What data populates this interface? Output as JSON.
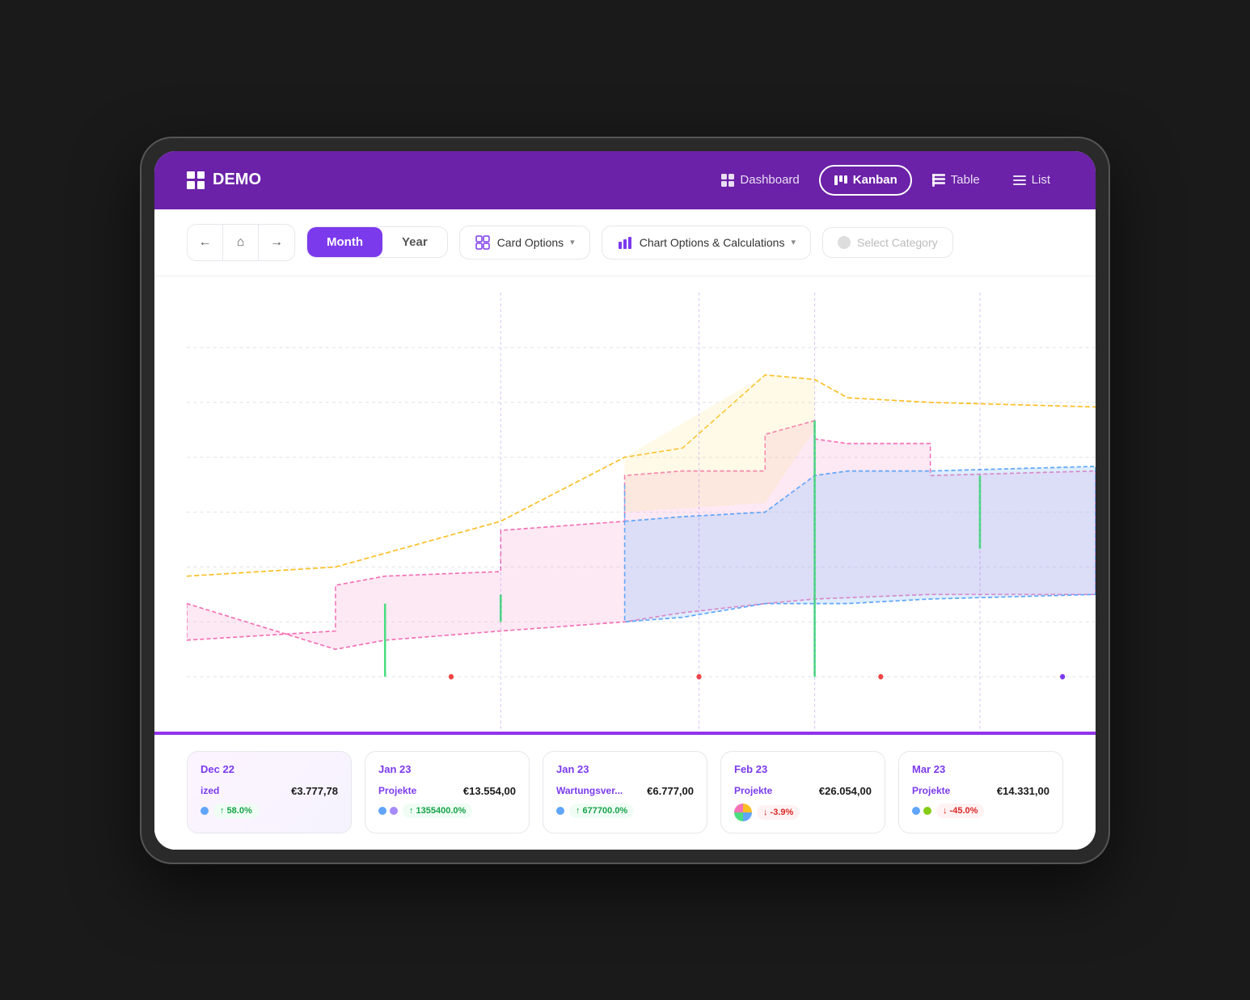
{
  "app": {
    "logo": "DEMO",
    "logo_aria": "demo-logo"
  },
  "nav": {
    "items": [
      {
        "id": "dashboard",
        "label": "Dashboard",
        "icon": "grid",
        "active": false
      },
      {
        "id": "kanban",
        "label": "Kanban",
        "icon": "kanban",
        "active": true
      },
      {
        "id": "table",
        "label": "Table",
        "icon": "table",
        "active": false
      },
      {
        "id": "list",
        "label": "List",
        "icon": "list",
        "active": false
      }
    ]
  },
  "toolbar": {
    "period_month": "Month",
    "period_year": "Year",
    "card_options": "Card Options",
    "chart_options": "Chart Options & Calculations",
    "select_category": "Select Category"
  },
  "chart": {
    "grid_lines": 8,
    "colors": {
      "pink": "#f9a8d4",
      "blue": "#93c5fd",
      "yellow": "#fde68a",
      "green": "#86efac",
      "purple": "#c4b5fd"
    }
  },
  "cards": [
    {
      "month": "Dec 22",
      "items": [
        {
          "name": "ized",
          "value": "€3.777,78",
          "dots": [],
          "badge": "up",
          "pct": "58.0%"
        }
      ]
    },
    {
      "month": "Jan 23",
      "items": [
        {
          "name": "Projekte",
          "value": "€13.554,00",
          "dots": [
            "#60a5fa",
            "#a78bfa"
          ],
          "badge": "up",
          "pct": "1355400.0%"
        }
      ]
    },
    {
      "month": "Jan 23",
      "items": [
        {
          "name": "Wartungsver...",
          "value": "€6.777,00",
          "dots": [
            "#60a5fa"
          ],
          "badge": "up",
          "pct": "677700.0%"
        }
      ]
    },
    {
      "month": "Feb 23",
      "items": [
        {
          "name": "Projekte",
          "value": "€26.054,00",
          "dots": [
            "multicolor"
          ],
          "badge": "down",
          "pct": "-3.9%"
        }
      ]
    },
    {
      "month": "Mar 23",
      "items": [
        {
          "name": "Projekte",
          "value": "€14.331,00",
          "dots": [
            "#60a5fa",
            "#84cc16"
          ],
          "badge": "down",
          "pct": "-45.0%"
        }
      ]
    }
  ]
}
